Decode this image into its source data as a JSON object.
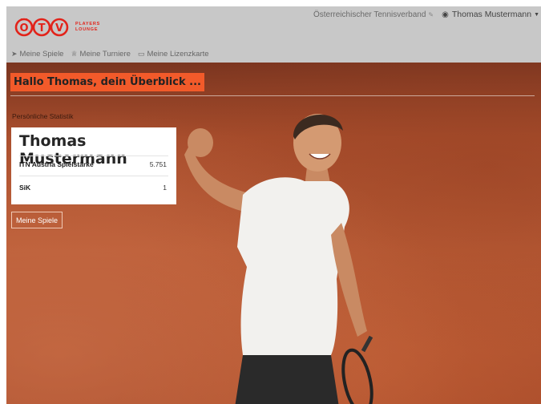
{
  "header": {
    "logo_text": "ÖTV",
    "logo_tag_line1": "PLAYERS",
    "logo_tag_line2": "LOUNGE",
    "org_link": "Österreichischer Tennisverband",
    "org_link_icon": "external-link-icon",
    "user_name": "Thomas Mustermann",
    "user_icon": "user-circle-icon"
  },
  "nav": [
    {
      "label": "Meine Spiele",
      "icon": "paper-plane-icon"
    },
    {
      "label": "Meine Turniere",
      "icon": "trophy-icon"
    },
    {
      "label": "Meine Lizenzkarte",
      "icon": "credit-card-icon"
    }
  ],
  "hero": {
    "title": "Hallo Thomas, dein Überblick ...",
    "stats_label": "Persönliche Statistik",
    "card": {
      "name": "Thomas Mustermann",
      "rows": [
        {
          "label": "ITN Austria Spielstärke",
          "value": "5.751"
        },
        {
          "label": "SiK",
          "value": "1"
        }
      ]
    },
    "button": "Meine Spiele"
  },
  "colors": {
    "brand_red": "#e2231a",
    "accent_orange": "#f25a2a",
    "topbar_bg": "#c8c8c8",
    "clay": "#b85a35"
  }
}
